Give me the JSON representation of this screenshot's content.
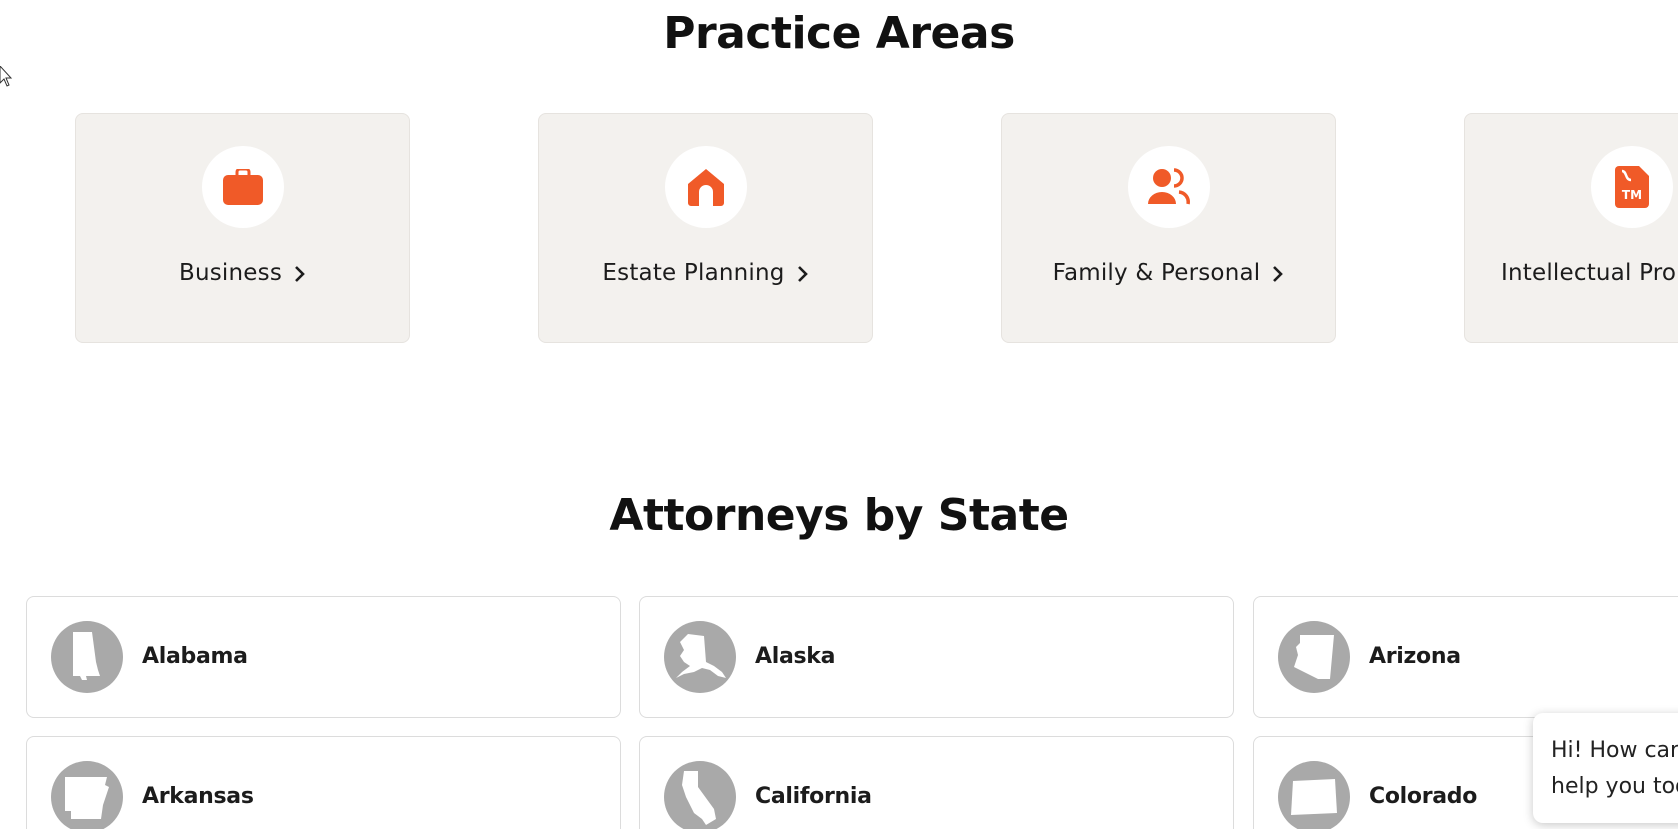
{
  "practice_section": {
    "title": "Practice Areas",
    "cards": [
      {
        "label": "Business",
        "icon": "briefcase-icon"
      },
      {
        "label": "Estate Planning",
        "icon": "house-icon"
      },
      {
        "label": "Family & Personal",
        "icon": "people-icon"
      },
      {
        "label": "Intellectual Property",
        "icon": "trademark-icon"
      }
    ]
  },
  "states_section": {
    "title": "Attorneys by State",
    "states": [
      {
        "name": "Alabama"
      },
      {
        "name": "Alaska"
      },
      {
        "name": "Arizona"
      },
      {
        "name": "Arkansas"
      },
      {
        "name": "California"
      },
      {
        "name": "Colorado"
      }
    ]
  },
  "chat": {
    "line1": "Hi! How can I",
    "line2": "help you today?"
  },
  "colors": {
    "accent": "#f05a28",
    "card_bg": "#f3f1ee",
    "state_icon_bg": "#a9a9a9"
  }
}
